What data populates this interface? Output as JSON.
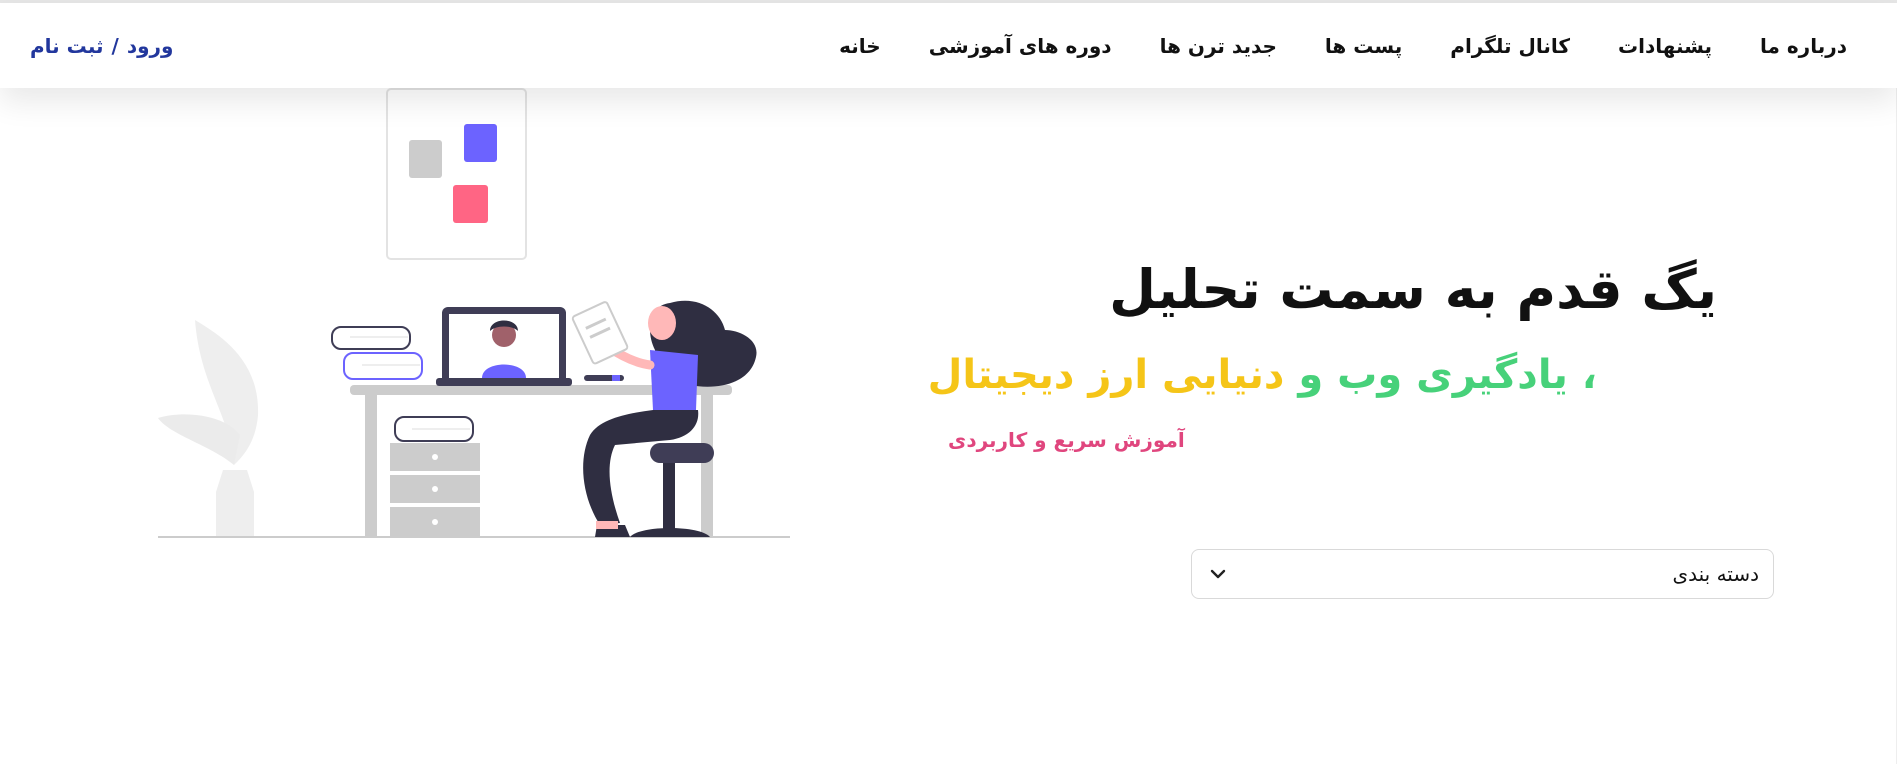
{
  "nav": {
    "items": [
      {
        "label": "خانه"
      },
      {
        "label": "دوره های آموزشی"
      },
      {
        "label": "جدید ترن ها"
      },
      {
        "label": "پست ها"
      },
      {
        "label": "کانال تلگرام"
      },
      {
        "label": "پشنهادات"
      },
      {
        "label": "درباره ما"
      }
    ],
    "login_label": "ورود",
    "auth_separator": "/",
    "register_label": "ثبت نام"
  },
  "hero": {
    "title": "یگ قدم به سمت تحلیل",
    "subtitle_comma": "،",
    "subtitle_web": "یادگیری وب",
    "subtitle_and": "و",
    "subtitle_crypto": "دنیایی ارز دیجیتال",
    "tagline": "آموزش سریع و کاربردی"
  },
  "category_select": {
    "selected": "دسته بندی",
    "icon": "chevron-down-icon"
  },
  "colors": {
    "brand_link": "#22379d",
    "green": "#47d17a",
    "yellow": "#f5c518",
    "pink": "#e0467e",
    "accent_purple": "#6c63ff",
    "accent_red": "#ff6584"
  },
  "illustration": {
    "icon": "woman-at-desk-video-call-illustration"
  }
}
